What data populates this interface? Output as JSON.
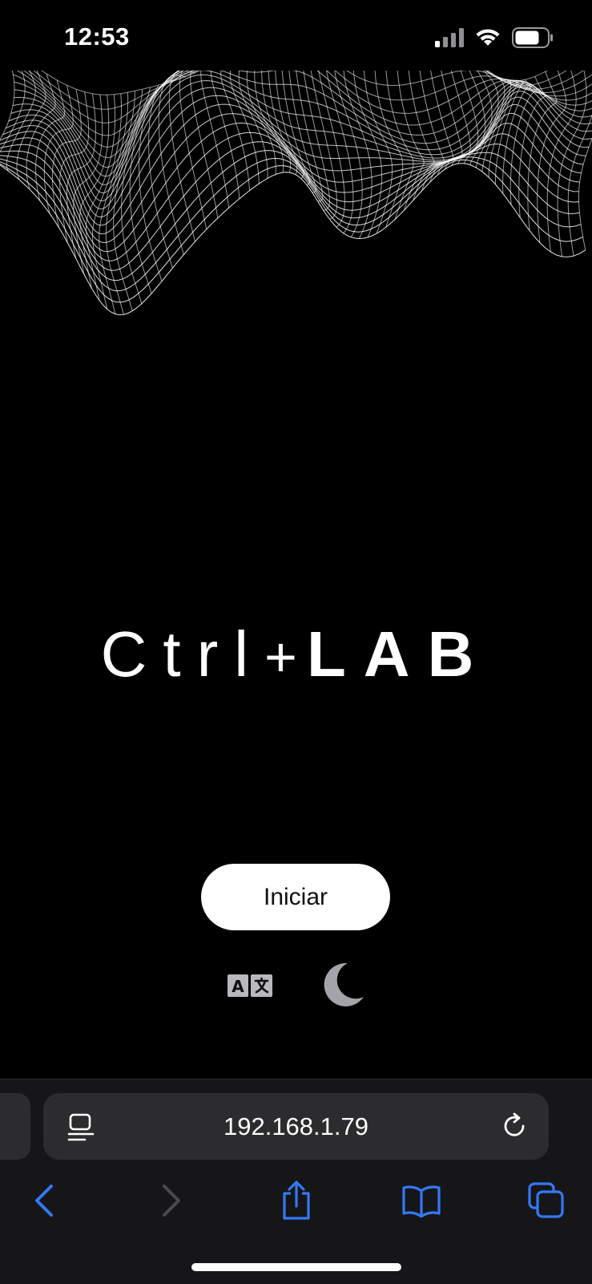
{
  "status_bar": {
    "time": "12:53",
    "icons": [
      "cellular-signal-icon",
      "wifi-icon",
      "battery-icon"
    ]
  },
  "hero": {
    "logo_ctrl": "Ctrl",
    "logo_plus": "+",
    "logo_lab": "LAB"
  },
  "actions": {
    "start_label": "Iniciar",
    "language_icon": "translate-icon",
    "theme_icon": "moon-icon"
  },
  "browser": {
    "url": "192.168.1.79",
    "toolbar_icons": [
      "back-icon",
      "forward-icon",
      "share-icon",
      "bookmarks-icon",
      "tabs-icon"
    ]
  },
  "colors": {
    "background": "#000000",
    "accent": "#3478f6",
    "toolbar_bg": "#161618",
    "field_bg": "#2c2c2e",
    "icon_grey": "#a3a3a8"
  }
}
